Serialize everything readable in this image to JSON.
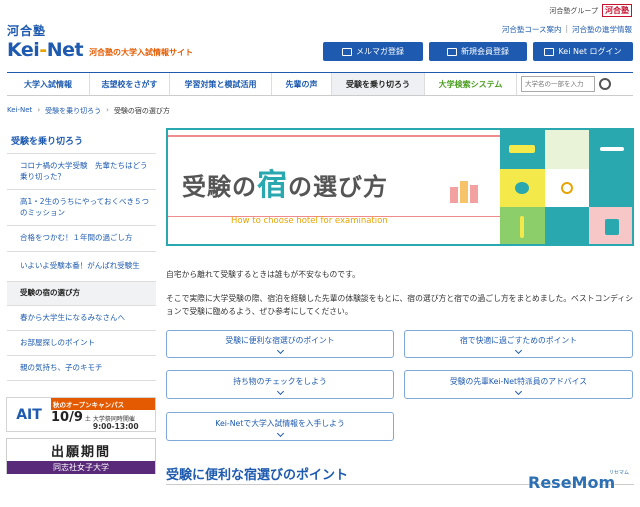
{
  "util": {
    "group_label": "河合塾グループ",
    "brand": "河合塾"
  },
  "header": {
    "logo_kawai": "河合塾",
    "logo_text_a": "Kei",
    "logo_text_b": "-",
    "logo_text_c": "Net",
    "tagline": "河合塾の大学入試情報サイト",
    "links": [
      "河合塾コース案内",
      "河合塾の進学情報"
    ],
    "buttons": [
      "メルマガ登録",
      "新規会員登録",
      "Kei Net ログイン"
    ]
  },
  "nav": {
    "items": [
      "大学入試情報",
      "志望校をさがす",
      "学習対策と模試活用",
      "先輩の声",
      "受験を乗り切ろう"
    ],
    "system_label": "大学検索システム",
    "search_placeholder": "大学名の一部を入力"
  },
  "breadcrumb": [
    "Kei-Net",
    "受験を乗り切ろう",
    "受験の宿の選び方"
  ],
  "sidebar": {
    "title": "受験を乗り切ろう",
    "items": [
      "コロナ禍の大学受験　先輩たちはどう乗り切った？",
      "高1・2生のうちにやっておくべき５つのミッション",
      "合格をつかむ！１年間の過ごし方",
      "いよいよ受験本番！がんばれ受験生",
      "受験の宿の選び方",
      "春から大学生になるみなさんへ",
      "お部屋探しのポイント",
      "親の気持ち、子のキモチ"
    ]
  },
  "banner1": {
    "ait": "AIT",
    "header": "秋のオープンキャンパス",
    "date": "10/9",
    "day": "土",
    "note": "大学祭同時開催",
    "time": "9:00-13:00"
  },
  "banner2": {
    "title": "出願期間",
    "school": "同志社女子大学"
  },
  "hero": {
    "title_a": "受験の",
    "title_b": "宿",
    "title_c": "の選び方",
    "subtitle": "How to choose hotel for examination"
  },
  "intro": {
    "p1": "自宅から離れて受験するときは誰もが不安なものです。",
    "p2": "そこで実際に大学受験の際、宿泊を経験した先輩の体験談をもとに、宿の選び方と宿での過ごし方をまとめました。ベストコンディションで受験に臨めるよう、ぜひ参考にしてください。"
  },
  "anchors": [
    "受験に便利な宿選びのポイント",
    "宿で快適に過ごすためのポイント",
    "持ち物のチェックをしよう",
    "受験の先輩Kei-Net特派員のアドバイス",
    "Kei-Netで大学入試情報を入手しよう"
  ],
  "section_heading": "受験に便利な宿選びのポイント",
  "watermark": {
    "text": "ReseMom",
    "sub": "リセマム"
  },
  "colors": {
    "primary": "#1e5bb0",
    "accent": "#e45a00",
    "teal": "#2aa8b0"
  }
}
